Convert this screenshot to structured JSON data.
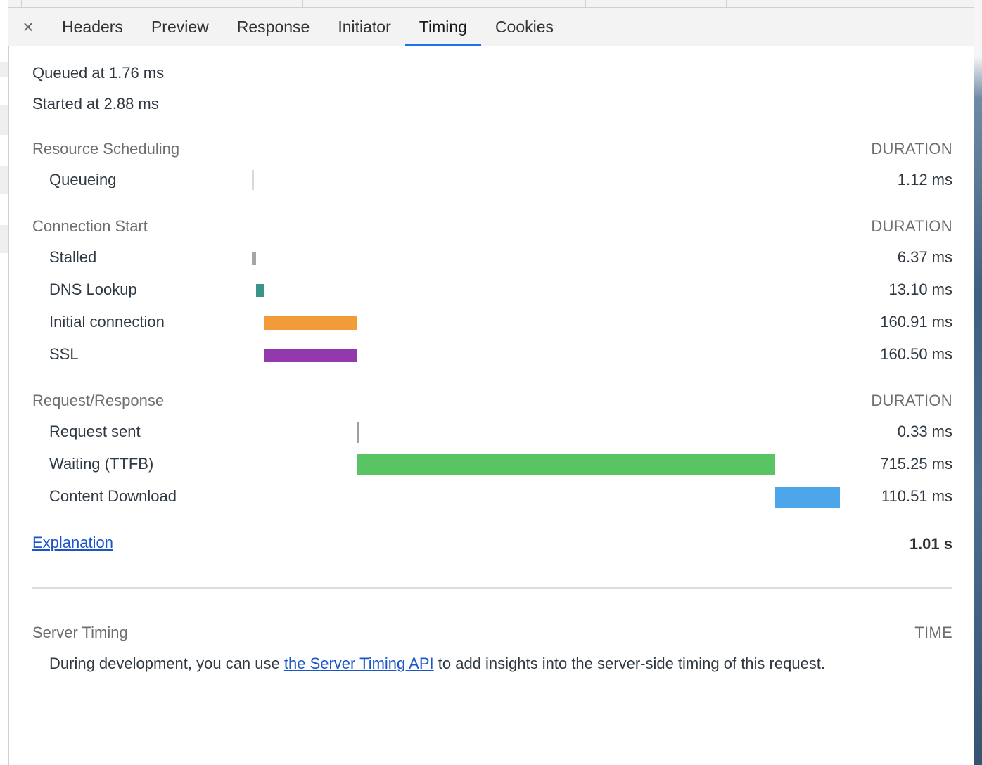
{
  "tabs": {
    "close_label": "×",
    "items": [
      {
        "label": "Headers",
        "active": false
      },
      {
        "label": "Preview",
        "active": false
      },
      {
        "label": "Response",
        "active": false
      },
      {
        "label": "Initiator",
        "active": false
      },
      {
        "label": "Timing",
        "active": true
      },
      {
        "label": "Cookies",
        "active": false
      }
    ]
  },
  "summary": {
    "queued": "Queued at 1.76 ms",
    "started": "Started at 2.88 ms"
  },
  "sections": {
    "scheduling": {
      "title": "Resource Scheduling",
      "column": "DURATION",
      "rows": [
        {
          "label": "Queueing",
          "value": "1.12 ms",
          "color": "#d9d9d9"
        }
      ]
    },
    "connection": {
      "title": "Connection Start",
      "column": "DURATION",
      "rows": [
        {
          "label": "Stalled",
          "value": "6.37 ms",
          "color": "#a6a6a6"
        },
        {
          "label": "DNS Lookup",
          "value": "13.10 ms",
          "color": "#3c9488"
        },
        {
          "label": "Initial connection",
          "value": "160.91 ms",
          "color": "#f29b3b"
        },
        {
          "label": "SSL",
          "value": "160.50 ms",
          "color": "#9139ad"
        }
      ]
    },
    "request": {
      "title": "Request/Response",
      "column": "DURATION",
      "rows": [
        {
          "label": "Request sent",
          "value": "0.33 ms",
          "color": "#a0a0a0"
        },
        {
          "label": "Waiting (TTFB)",
          "value": "715.25 ms",
          "color": "#59c464"
        },
        {
          "label": "Content Download",
          "value": "110.51 ms",
          "color": "#4da6ea"
        }
      ]
    }
  },
  "footer": {
    "explanation_link": "Explanation",
    "total": "1.01 s"
  },
  "server_timing": {
    "title": "Server Timing",
    "column": "TIME",
    "text_before": "During development, you can use ",
    "link": "the Server Timing API",
    "text_after": " to add insights into the server-side timing of this request."
  }
}
